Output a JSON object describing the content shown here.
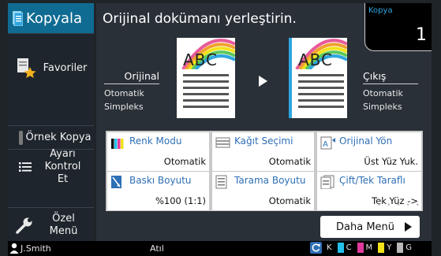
{
  "sidebar": {
    "title": "Kopyala",
    "items": [
      {
        "label": "Favoriler"
      },
      {
        "label": "Örnek Kopya"
      },
      {
        "label": "Ayarı Kontrol Et"
      },
      {
        "label": "Özel Menü"
      }
    ]
  },
  "main": {
    "prompt": "Orijinal dokümanı yerleştirin.",
    "copy_label": "Kopya",
    "copy_count": "1",
    "original": {
      "heading": "Orijinal",
      "line1": "Otomatik",
      "line2": "Simpleks"
    },
    "output": {
      "heading": "Çıkış",
      "line1": "Otomatik",
      "line2": "Simpleks"
    },
    "doc_text": "ABC"
  },
  "tiles": [
    {
      "title": "Renk Modu",
      "value": "Otomatik"
    },
    {
      "title": "Kağıt Seçimi",
      "value": "Otomatik"
    },
    {
      "title": "Orijinal Yön",
      "value": "Üst Yüz Yuk."
    },
    {
      "title": "Baskı Boyutu",
      "value": "%100 (1:1)"
    },
    {
      "title": "Tarama Boyutu",
      "value": "Otomatik"
    },
    {
      "title": "Çift/Tek Taraflı",
      "value": "Tek Yüz ->"
    }
  ],
  "more_button": "Daha Menü",
  "pager_dots": "• • • • •",
  "status": {
    "user": "J.Smith",
    "state": "Atıl",
    "toner": [
      {
        "letter": "K",
        "color": "#111111"
      },
      {
        "letter": "C",
        "color": "#22c0ea"
      },
      {
        "letter": "M",
        "color": "#e23a9c"
      },
      {
        "letter": "Y",
        "color": "#f2e21a"
      },
      {
        "letter": "G",
        "color": "#b8b8b8"
      }
    ]
  },
  "colors": {
    "accent": "#0f6b92",
    "link_blue": "#2e6fb5"
  }
}
